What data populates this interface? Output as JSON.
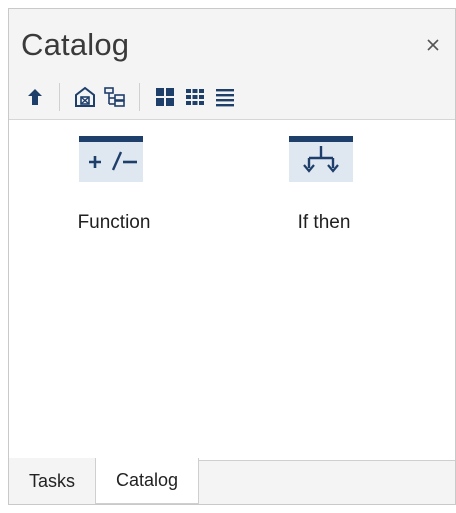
{
  "pane": {
    "title": "Catalog",
    "close_glyph": "×"
  },
  "toolbar": {
    "buttons": [
      {
        "name": "up-arrow-icon"
      },
      {
        "name": "home-icon"
      },
      {
        "name": "tree-view-icon"
      },
      {
        "name": "large-icons-view-icon",
        "selected": true
      },
      {
        "name": "small-icons-view-icon"
      },
      {
        "name": "list-view-icon"
      }
    ]
  },
  "catalog_items": [
    {
      "label": "Function",
      "icon": "function-plus-minus-icon"
    },
    {
      "label": "If then",
      "icon": "if-then-branch-icon"
    }
  ],
  "tabs": [
    {
      "label": "Tasks",
      "active": false
    },
    {
      "label": "Catalog",
      "active": true
    }
  ],
  "colors": {
    "accent_blue": "#1f3f6b",
    "icon_bg": "#dfe7f1",
    "panel_bg": "#f4f4f4",
    "content_bg": "#ffffff"
  }
}
